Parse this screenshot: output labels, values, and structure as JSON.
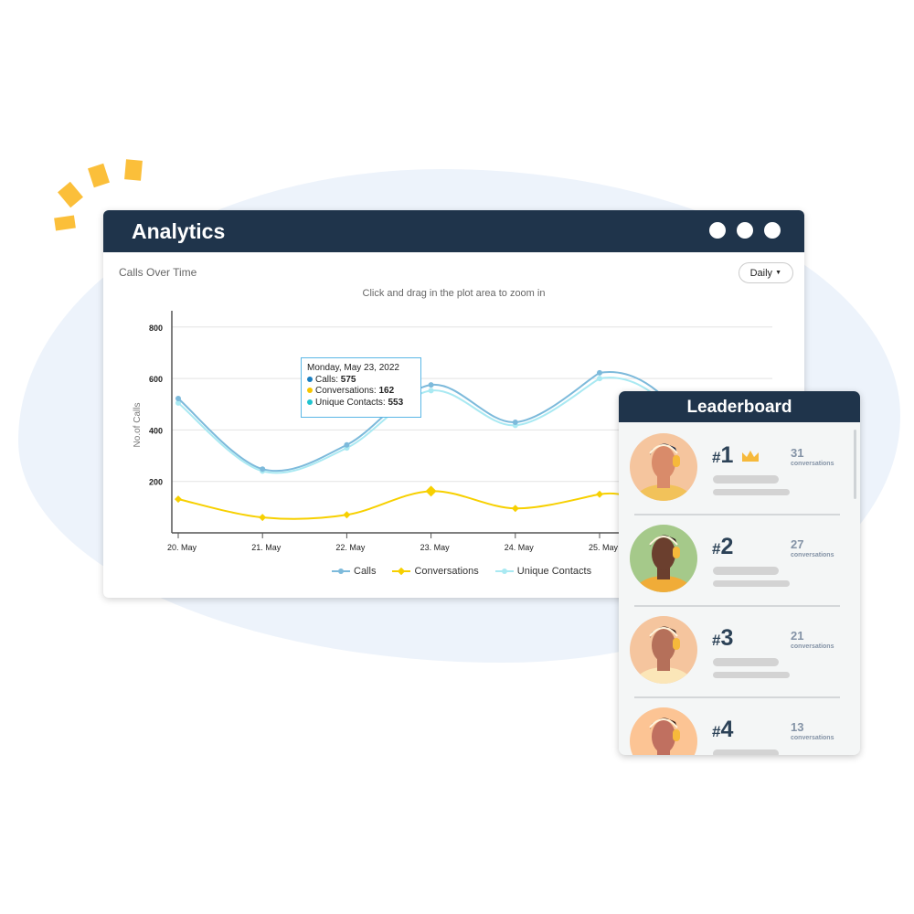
{
  "window": {
    "title": "Analytics",
    "controls": [
      "dot",
      "dot",
      "dot"
    ]
  },
  "panel": {
    "subtitle": "Calls Over Time",
    "period_select": "Daily",
    "zoom_hint": "Click and drag in the plot area to zoom in"
  },
  "tooltip": {
    "date": "Monday, May 23, 2022",
    "rows": [
      {
        "label": "Calls:",
        "value": "575",
        "color": "#1a7fc1"
      },
      {
        "label": "Conversations:",
        "value": "162",
        "color": "#f7c600"
      },
      {
        "label": "Unique Contacts:",
        "value": "553",
        "color": "#1fc4cf"
      }
    ]
  },
  "chart_data": {
    "type": "line",
    "ylabel": "No.of Calls",
    "ylim": [
      0,
      860
    ],
    "yticks": [
      "200",
      "400",
      "600",
      "800"
    ],
    "categories": [
      "20. May",
      "21. May",
      "22. May",
      "23. May",
      "24. May",
      "25. May"
    ],
    "grid": true,
    "legend_position": "bottom",
    "series": [
      {
        "name": "Calls",
        "color": "#7dbadb",
        "marker": "circle",
        "values": [
          522,
          248,
          342,
          575,
          430,
          622
        ]
      },
      {
        "name": "Conversations",
        "color": "#f7d000",
        "marker": "diamond",
        "values": [
          131,
          60,
          70,
          162,
          95,
          150
        ]
      },
      {
        "name": "Unique Contacts",
        "color": "#a9e9f2",
        "marker": "circle",
        "values": [
          505,
          240,
          330,
          553,
          418,
          600
        ]
      }
    ]
  },
  "leaderboard": {
    "title": "Leaderboard",
    "entries": [
      {
        "rank": "1",
        "count": "31",
        "unit": "conversations",
        "bg": "#f5c59e",
        "shirt": "#f2c25a",
        "skin": "#d98b6a",
        "hair": "#14213d"
      },
      {
        "rank": "2",
        "count": "27",
        "unit": "conversations",
        "bg": "#a5c98a",
        "shirt": "#f0ac38",
        "skin": "#6b3f2e",
        "hair": "#231815"
      },
      {
        "rank": "3",
        "count": "21",
        "unit": "conversations",
        "bg": "#f5c59e",
        "shirt": "#fbe6b8",
        "skin": "#b5705a",
        "hair": "#3a2018"
      },
      {
        "rank": "4",
        "count": "13",
        "unit": "conversations",
        "bg": "#fcc494",
        "shirt": "#f2c25a",
        "skin": "#c07060",
        "hair": "#3a1e15"
      }
    ]
  }
}
